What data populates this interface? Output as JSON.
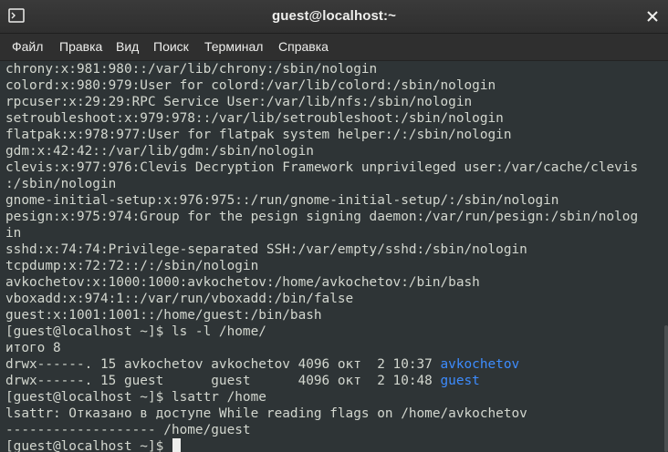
{
  "window": {
    "title": "guest@localhost:~"
  },
  "menu": [
    "Файл",
    "Правка",
    "Вид",
    "Поиск",
    "Терминал",
    "Справка"
  ],
  "terminal": {
    "lines": [
      "chrony:x:981:980::/var/lib/chrony:/sbin/nologin",
      "colord:x:980:979:User for colord:/var/lib/colord:/sbin/nologin",
      "rpcuser:x:29:29:RPC Service User:/var/lib/nfs:/sbin/nologin",
      "setroubleshoot:x:979:978::/var/lib/setroubleshoot:/sbin/nologin",
      "flatpak:x:978:977:User for flatpak system helper:/:/sbin/nologin",
      "gdm:x:42:42::/var/lib/gdm:/sbin/nologin",
      "clevis:x:977:976:Clevis Decryption Framework unprivileged user:/var/cache/clevis",
      ":/sbin/nologin",
      "gnome-initial-setup:x:976:975::/run/gnome-initial-setup/:/sbin/nologin",
      "pesign:x:975:974:Group for the pesign signing daemon:/var/run/pesign:/sbin/nolog",
      "in",
      "sshd:x:74:74:Privilege-separated SSH:/var/empty/sshd:/sbin/nologin",
      "tcpdump:x:72:72::/:/sbin/nologin",
      "avkochetov:x:1000:1000:avkochetov:/home/avkochetov:/bin/bash",
      "vboxadd:x:974:1::/var/run/vboxadd:/bin/false",
      "guest:x:1001:1001::/home/guest:/bin/bash",
      "[guest@localhost ~]$ ls -l /home/",
      "итого 8"
    ],
    "ls_rows": [
      {
        "prefix": "drwx------. 15 avkochetov avkochetov 4096 окт  2 10:37 ",
        "name": "avkochetov"
      },
      {
        "prefix": "drwx------. 15 guest      guest      4096 окт  2 10:48 ",
        "name": "guest"
      }
    ],
    "tail_lines": [
      "[guest@localhost ~]$ lsattr /home",
      "lsattr: Отказано в доступе While reading flags on /home/avkochetov",
      "------------------- /home/guest"
    ],
    "prompt": "[guest@localhost ~]$ "
  },
  "colors": {
    "background": "#2e3436",
    "foreground": "#d3d7cf",
    "directory": "#3d8cff"
  }
}
